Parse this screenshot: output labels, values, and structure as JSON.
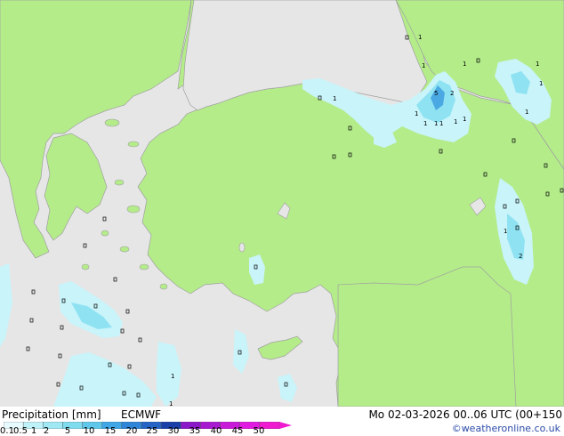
{
  "footer": {
    "title": "Precipitation [mm]",
    "model": "ECMWF",
    "valid": "Mo 02-03-2026 00..06 UTC (00+150",
    "credit": "©weatheronline.co.uk"
  },
  "legend": {
    "ticks": [
      "0.1",
      "0.5",
      "1",
      "2",
      "5",
      "10",
      "15",
      "20",
      "25",
      "30",
      "35",
      "40",
      "45",
      "50"
    ],
    "colors": [
      "#e6faff",
      "#bff2f8",
      "#9fe8f4",
      "#7fdcef",
      "#5fc8ea",
      "#3fa7e6",
      "#2f86d9",
      "#2563c4",
      "#1a3fa8",
      "#8a18c8",
      "#a81ad0",
      "#c81ad8",
      "#e01ae0",
      "#f01ad0"
    ]
  },
  "map": {
    "land_color": "#b4ec8a",
    "sea_color": "#e6e6e6",
    "coast_color": "#a0a0a0",
    "precip_light": "#c8f4fa",
    "precip_mid": "#8fe2f2",
    "precip_strong": "#4aa8e2",
    "values": [
      "1",
      "1",
      "1",
      "1",
      "1",
      "1",
      "1",
      "1",
      "1",
      "1",
      "1",
      "1",
      "1",
      "1",
      "1",
      "2",
      "2",
      "5",
      "1"
    ]
  }
}
